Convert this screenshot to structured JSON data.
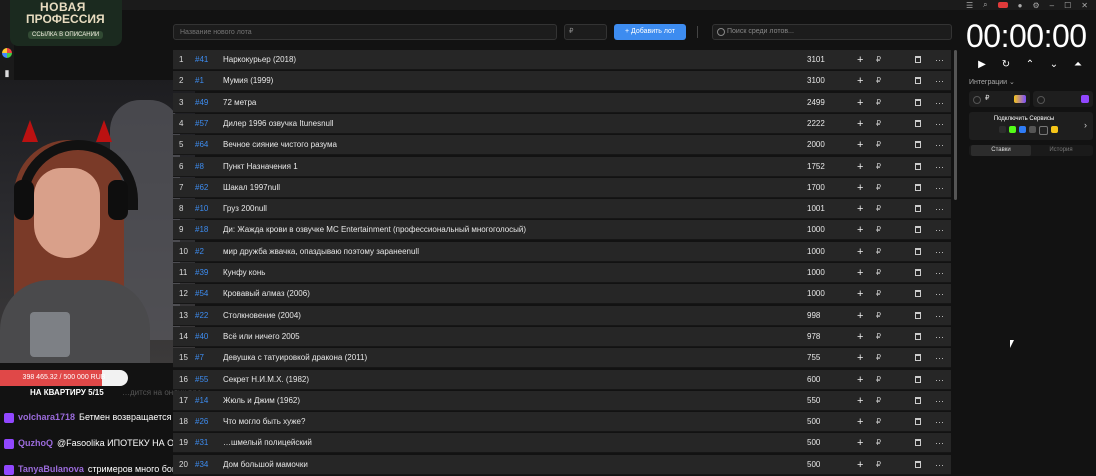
{
  "overlay": {
    "logo_line1": "НОВАЯ",
    "logo_line2": "ПРОФЕССИЯ",
    "logo_sub": "ССЫЛКА В ОПИСАНИИ",
    "donation_text": "398 465.32 / 500 000 RUB",
    "donation_fraction": 0.797,
    "goal_label": "НА КВАРТИРУ 5/15",
    "faint_text": "…дится на онлик бро",
    "accent_red": "#e04848"
  },
  "chat": [
    {
      "nick": "volchara1718",
      "msg": "Бетмен возвращается"
    },
    {
      "nick": "QuzhoQ",
      "msg": "@Fasoolika ИПОТЕКУ НА ОСТАТОК ВСЕЙ ЖИЗНИ ВСЕ!"
    },
    {
      "nick": "TanyaBulanova",
      "msg": "стримеров много богатых"
    }
  ],
  "topbar": {
    "lot_placeholder": "Название нового лота",
    "price_placeholder": "₽",
    "add_button": "+ Добавить лот",
    "search_placeholder": "Поиск среди лотов..."
  },
  "lots": [
    {
      "n": "1",
      "id": "#41",
      "name": "Наркокурьер (2018)",
      "amount": "3101"
    },
    {
      "n": "2",
      "id": "#1",
      "name": "Мумия (1999)",
      "amount": "3100"
    },
    {
      "n": "3",
      "id": "#49",
      "name": "72 метра",
      "amount": "2499"
    },
    {
      "n": "4",
      "id": "#57",
      "name": "Дилер 1996 озвучка Itunesnull",
      "amount": "2222"
    },
    {
      "n": "5",
      "id": "#64",
      "name": "Вечное сияние чистого разума",
      "amount": "2000"
    },
    {
      "n": "6",
      "id": "#8",
      "name": "Пункт Назначения 1",
      "amount": "1752"
    },
    {
      "n": "7",
      "id": "#62",
      "name": "Шакал 1997null",
      "amount": "1700"
    },
    {
      "n": "8",
      "id": "#10",
      "name": "Груз 200null",
      "amount": "1001"
    },
    {
      "n": "9",
      "id": "#18",
      "name": "Ди: Жажда крови в озвучке  MC Entertainment (профессиональный многоголосый)",
      "amount": "1000"
    },
    {
      "n": "10",
      "id": "#2",
      "name": "мир дружба жвачка, опаздываю поэтому заранееnull",
      "amount": "1000"
    },
    {
      "n": "11",
      "id": "#39",
      "name": "Кунфу конь",
      "amount": "1000"
    },
    {
      "n": "12",
      "id": "#54",
      "name": "Кровавый алмаз (2006)",
      "amount": "1000"
    },
    {
      "n": "13",
      "id": "#22",
      "name": "Столкновение (2004)",
      "amount": "998"
    },
    {
      "n": "14",
      "id": "#40",
      "name": "Всё или ничего 2005",
      "amount": "978"
    },
    {
      "n": "15",
      "id": "#7",
      "name": "Девушка с татуировкой дракона (2011)",
      "amount": "755"
    },
    {
      "n": "16",
      "id": "#55",
      "name": "Секрет Н.И.М.Х. (1982)",
      "amount": "600"
    },
    {
      "n": "17",
      "id": "#14",
      "name": "Жюль и Джим (1962)",
      "amount": "550"
    },
    {
      "n": "18",
      "id": "#26",
      "name": "Что могло быть хуже?",
      "amount": "500"
    },
    {
      "n": "19",
      "id": "#31",
      "name": "…шмелый полицейский",
      "amount": "500"
    },
    {
      "n": "20",
      "id": "#34",
      "name": "Дом большой мамочки",
      "amount": "500"
    }
  ],
  "row_icons": {
    "plus": "+",
    "currency": "₽",
    "more": "···"
  },
  "sidebar": {
    "timer": "00:00:00",
    "integrations_label": "Интеграции ⌄",
    "pill1_label": "₽",
    "pill2_label": "",
    "services_label": "Подключить Сервисы",
    "services_arrow": "›",
    "tab_active": "Ставки",
    "tab_inactive": "История"
  }
}
